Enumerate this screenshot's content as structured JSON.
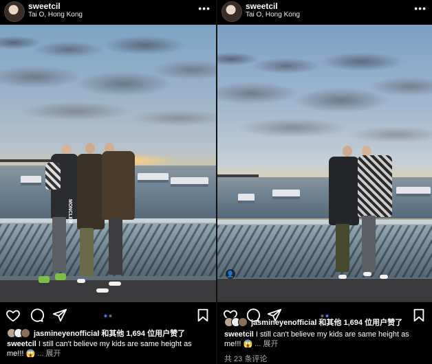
{
  "posts": [
    {
      "username": "sweetcil",
      "location": "Tai O, Hong Kong",
      "more_icon": "more-horizontal-icon",
      "carousel": {
        "count": 2,
        "active": 1
      },
      "likes_text": "jasmineyenofficial 和其他 1,694 位用户赞了",
      "caption_user": "sweetcil",
      "caption_text": "I still can't believe my kids are same height as me!!!",
      "caption_emoji": "😱",
      "caption_more": "... 展开"
    },
    {
      "username": "sweetcil",
      "location": "Tai O, Hong Kong",
      "more_icon": "more-horizontal-icon",
      "carousel": {
        "count": 2,
        "active": 2
      },
      "likes_text": "jasmineyenofficial 和其他 1,694 位用户赞了",
      "caption_user": "sweetcil",
      "caption_text": "I still can't believe my kids are same height as me!!!",
      "caption_emoji": "😱",
      "caption_more": "... 展开",
      "comments_text": "共 23 条评论"
    }
  ],
  "photo_badge": "MONCLER",
  "colors": {
    "accent": "#2f80ff",
    "bg": "#000000"
  }
}
